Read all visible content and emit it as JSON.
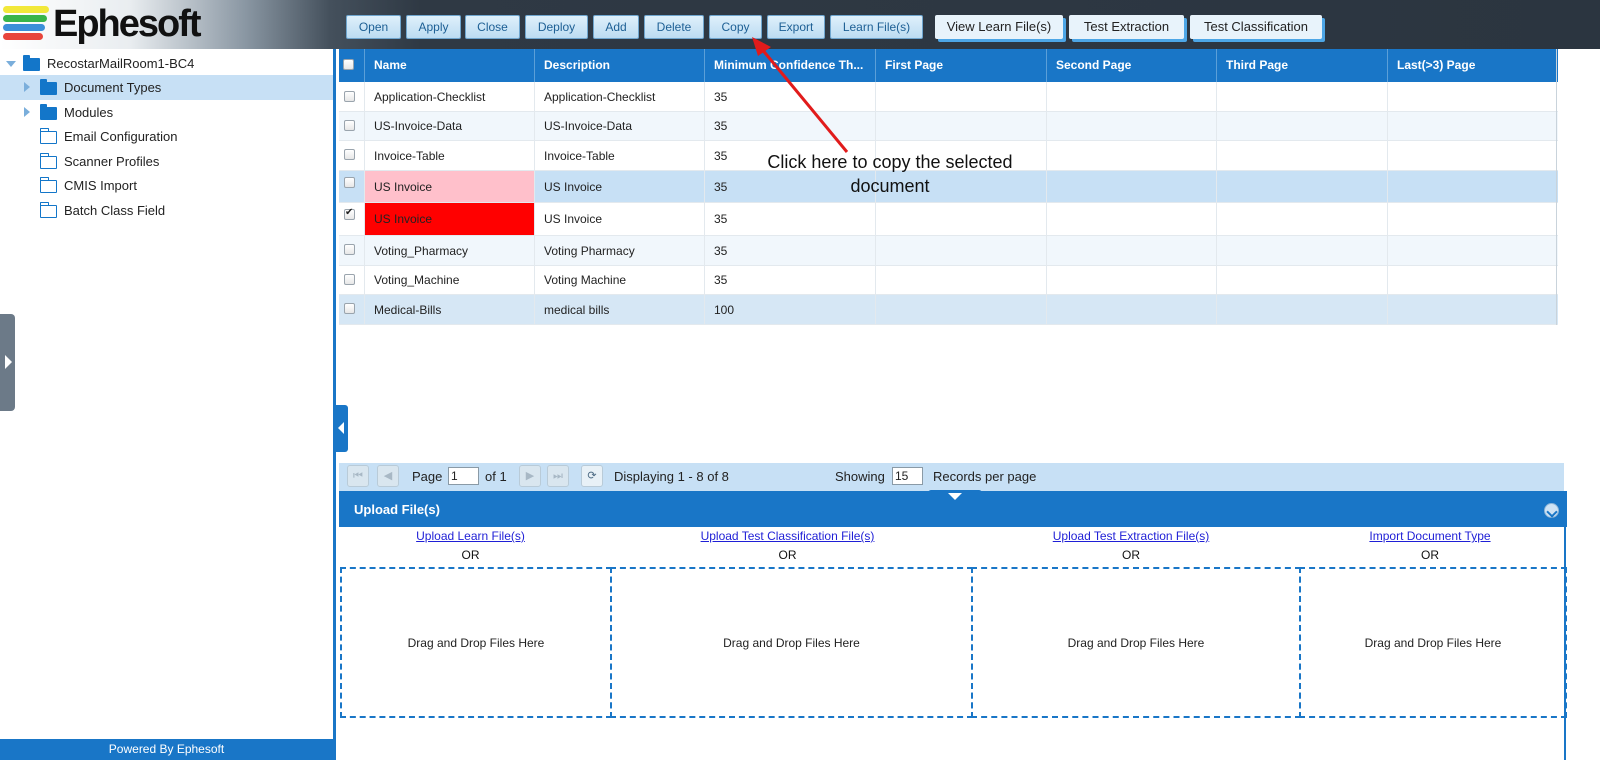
{
  "brand": {
    "name": "Ephesoft",
    "stripe_colors": [
      "#f2e83a",
      "#39b54a",
      "#3b8fd9",
      "#e8453c"
    ]
  },
  "toolbar": {
    "buttons": [
      "Open",
      "Apply",
      "Close",
      "Deploy",
      "Add",
      "Delete",
      "Copy",
      "Export",
      "Learn File(s)"
    ],
    "tabs": [
      "View Learn File(s)",
      "Test Extraction",
      "Test Classification"
    ]
  },
  "tree": {
    "root": "RecostarMailRoom1-BC4",
    "items": [
      "Document Types",
      "Modules",
      "Email Configuration",
      "Scanner Profiles",
      "CMIS Import",
      "Batch Class Field"
    ]
  },
  "footer": {
    "powered": "Powered By Ephesoft"
  },
  "grid": {
    "columns": [
      "Name",
      "Description",
      "Minimum Confidence Th...",
      "First Page",
      "Second Page",
      "Third Page",
      "Last(>3) Page"
    ],
    "rows": [
      {
        "name": "Application-Checklist",
        "description": "Application-Checklist",
        "confidence": "35",
        "checked": false
      },
      {
        "name": "US-Invoice-Data",
        "description": "US-Invoice-Data",
        "confidence": "35",
        "checked": false
      },
      {
        "name": "Invoice-Table",
        "description": "Invoice-Table",
        "confidence": "35",
        "checked": false
      },
      {
        "name": "US Invoice",
        "description": "US Invoice",
        "confidence": "35",
        "checked": false
      },
      {
        "name": "US Invoice",
        "description": "US Invoice",
        "confidence": "35",
        "checked": true
      },
      {
        "name": "Voting_Pharmacy",
        "description": "Voting Pharmacy",
        "confidence": "35",
        "checked": false
      },
      {
        "name": "Voting_Machine",
        "description": "Voting Machine",
        "confidence": "35",
        "checked": false
      },
      {
        "name": "Medical-Bills",
        "description": "medical bills",
        "confidence": "100",
        "checked": false
      }
    ]
  },
  "pager": {
    "page_label": "Page",
    "page_value": "1",
    "of_label": "of 1",
    "displaying": "Displaying 1 - 8 of 8",
    "showing_label": "Showing",
    "per_page_value": "15",
    "records_label": "Records per page"
  },
  "upload": {
    "title": "Upload File(s)",
    "columns": [
      {
        "link": "Upload Learn File(s)",
        "or": "OR",
        "drop": "Drag and Drop Files Here"
      },
      {
        "link": "Upload Test Classification File(s)",
        "or": "OR",
        "drop": "Drag and Drop Files Here"
      },
      {
        "link": "Upload Test Extraction File(s)",
        "or": "OR",
        "drop": "Drag and Drop Files Here"
      },
      {
        "link": "Import Document Type",
        "or": "OR",
        "drop": "Drag and Drop Files Here"
      }
    ]
  },
  "annotation": {
    "line1": "Click here to copy the selected",
    "line2": "document",
    "color": "#e11b1b"
  },
  "colors": {
    "accent": "#1976c7",
    "selected_row": "#c7e0f5",
    "pink": "#ffc0cb",
    "red": "#ff0000"
  }
}
